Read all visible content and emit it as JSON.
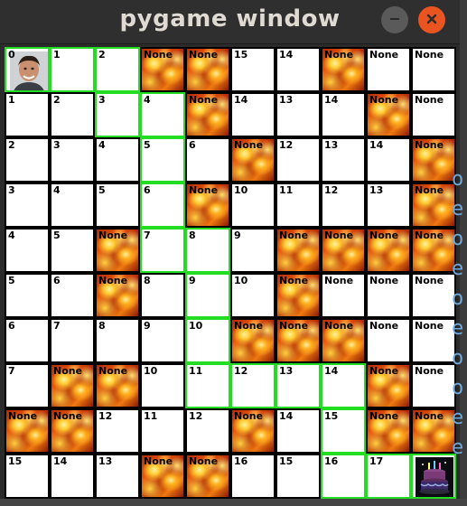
{
  "window": {
    "title": "pygame window",
    "minimize_icon": "minimize-icon",
    "close_icon": "close-icon",
    "colors": {
      "titlebar": "#2f2f2f",
      "close": "#e95420",
      "path_border": "#22dd22",
      "wall_border": "#000000"
    }
  },
  "grid": [
    [
      {
        "label": "0",
        "type": "player"
      },
      {
        "label": "1",
        "type": "path"
      },
      {
        "label": "2",
        "type": "path"
      },
      {
        "label": "None",
        "type": "fire"
      },
      {
        "label": "None",
        "type": "fire"
      },
      {
        "label": "15",
        "type": "empty"
      },
      {
        "label": "14",
        "type": "empty"
      },
      {
        "label": "None",
        "type": "fire"
      },
      {
        "label": "None",
        "type": "empty"
      },
      {
        "label": "None",
        "type": "empty"
      }
    ],
    [
      {
        "label": "1",
        "type": "empty"
      },
      {
        "label": "2",
        "type": "empty"
      },
      {
        "label": "3",
        "type": "path"
      },
      {
        "label": "4",
        "type": "path"
      },
      {
        "label": "None",
        "type": "fire"
      },
      {
        "label": "14",
        "type": "empty"
      },
      {
        "label": "13",
        "type": "empty"
      },
      {
        "label": "14",
        "type": "empty"
      },
      {
        "label": "None",
        "type": "fire"
      },
      {
        "label": "None",
        "type": "empty"
      }
    ],
    [
      {
        "label": "2",
        "type": "empty"
      },
      {
        "label": "3",
        "type": "empty"
      },
      {
        "label": "4",
        "type": "empty"
      },
      {
        "label": "5",
        "type": "path"
      },
      {
        "label": "6",
        "type": "empty"
      },
      {
        "label": "None",
        "type": "fire"
      },
      {
        "label": "12",
        "type": "empty"
      },
      {
        "label": "13",
        "type": "empty"
      },
      {
        "label": "14",
        "type": "empty"
      },
      {
        "label": "None",
        "type": "fire"
      }
    ],
    [
      {
        "label": "3",
        "type": "empty"
      },
      {
        "label": "4",
        "type": "empty"
      },
      {
        "label": "5",
        "type": "empty"
      },
      {
        "label": "6",
        "type": "path"
      },
      {
        "label": "None",
        "type": "fire"
      },
      {
        "label": "10",
        "type": "empty"
      },
      {
        "label": "11",
        "type": "empty"
      },
      {
        "label": "12",
        "type": "empty"
      },
      {
        "label": "13",
        "type": "empty"
      },
      {
        "label": "None",
        "type": "fire"
      }
    ],
    [
      {
        "label": "4",
        "type": "empty"
      },
      {
        "label": "5",
        "type": "empty"
      },
      {
        "label": "None",
        "type": "fire"
      },
      {
        "label": "7",
        "type": "path"
      },
      {
        "label": "8",
        "type": "path"
      },
      {
        "label": "9",
        "type": "empty"
      },
      {
        "label": "None",
        "type": "fire"
      },
      {
        "label": "None",
        "type": "fire"
      },
      {
        "label": "None",
        "type": "fire"
      },
      {
        "label": "None",
        "type": "fire"
      }
    ],
    [
      {
        "label": "5",
        "type": "empty"
      },
      {
        "label": "6",
        "type": "empty"
      },
      {
        "label": "None",
        "type": "fire"
      },
      {
        "label": "8",
        "type": "empty"
      },
      {
        "label": "9",
        "type": "path"
      },
      {
        "label": "10",
        "type": "empty"
      },
      {
        "label": "None",
        "type": "fire"
      },
      {
        "label": "None",
        "type": "empty"
      },
      {
        "label": "None",
        "type": "empty"
      },
      {
        "label": "None",
        "type": "empty"
      }
    ],
    [
      {
        "label": "6",
        "type": "empty"
      },
      {
        "label": "7",
        "type": "empty"
      },
      {
        "label": "8",
        "type": "empty"
      },
      {
        "label": "9",
        "type": "empty"
      },
      {
        "label": "10",
        "type": "path"
      },
      {
        "label": "None",
        "type": "fire"
      },
      {
        "label": "None",
        "type": "fire"
      },
      {
        "label": "None",
        "type": "fire"
      },
      {
        "label": "None",
        "type": "empty"
      },
      {
        "label": "None",
        "type": "empty"
      }
    ],
    [
      {
        "label": "7",
        "type": "empty"
      },
      {
        "label": "None",
        "type": "fire"
      },
      {
        "label": "None",
        "type": "fire"
      },
      {
        "label": "10",
        "type": "empty"
      },
      {
        "label": "11",
        "type": "path"
      },
      {
        "label": "12",
        "type": "path"
      },
      {
        "label": "13",
        "type": "path"
      },
      {
        "label": "14",
        "type": "path"
      },
      {
        "label": "None",
        "type": "fire"
      },
      {
        "label": "None",
        "type": "empty"
      }
    ],
    [
      {
        "label": "None",
        "type": "fire"
      },
      {
        "label": "None",
        "type": "fire"
      },
      {
        "label": "12",
        "type": "empty"
      },
      {
        "label": "11",
        "type": "empty"
      },
      {
        "label": "12",
        "type": "empty"
      },
      {
        "label": "None",
        "type": "fire"
      },
      {
        "label": "14",
        "type": "empty"
      },
      {
        "label": "15",
        "type": "path"
      },
      {
        "label": "None",
        "type": "fire"
      },
      {
        "label": "None",
        "type": "fire"
      }
    ],
    [
      {
        "label": "15",
        "type": "empty"
      },
      {
        "label": "14",
        "type": "empty"
      },
      {
        "label": "13",
        "type": "empty"
      },
      {
        "label": "None",
        "type": "fire"
      },
      {
        "label": "None",
        "type": "fire"
      },
      {
        "label": "16",
        "type": "empty"
      },
      {
        "label": "15",
        "type": "empty"
      },
      {
        "label": "16",
        "type": "path"
      },
      {
        "label": "17",
        "type": "path"
      },
      {
        "label": "",
        "type": "goal"
      }
    ]
  ],
  "side_text": [
    "o",
    "e",
    "o",
    "e",
    "o",
    "e",
    "o",
    "o",
    "e",
    "e"
  ]
}
